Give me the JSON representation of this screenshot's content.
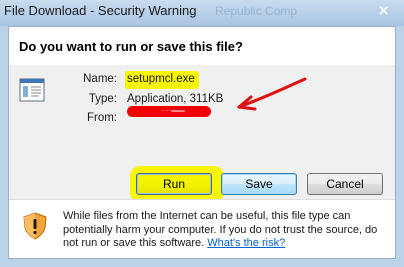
{
  "window": {
    "title": "File Download - Security Warning",
    "background_title_ghost": "Republic Comp"
  },
  "dialog": {
    "question": "Do you want to run or save this file?",
    "file": {
      "icon": "application-file-icon",
      "name_label": "Name:",
      "name_value": "setupmcl.exe",
      "type_label": "Type:",
      "type_value": "Application, 311KB",
      "from_label": "From:",
      "from_value": "......"
    },
    "buttons": {
      "run": "Run",
      "save": "Save",
      "cancel": "Cancel"
    },
    "warning": {
      "icon": "security-shield-icon",
      "text": "While files from the Internet can be useful, this file type can potentially harm your computer. If you do not trust the source, do not run or save this software.",
      "link": "What's the risk?"
    }
  },
  "annotations": {
    "highlight_color": "#f8f600",
    "redaction_color": "#f00000",
    "arrow_color": "#e01010"
  }
}
